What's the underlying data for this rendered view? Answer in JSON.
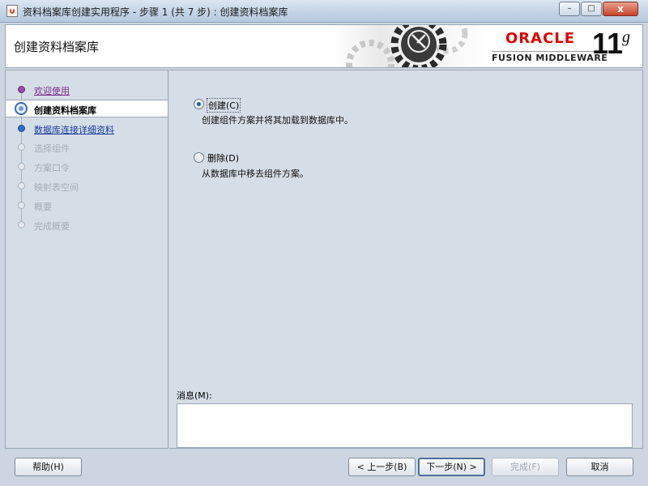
{
  "window": {
    "title": "资料档案库创建实用程序 - 步骤 1 (共 7 步) : 创建资料档案库",
    "minimize": "–",
    "maximize": "□",
    "close": "x"
  },
  "header": {
    "page_title": "创建资料档案库",
    "brand": "ORACLE",
    "product": "FUSION MIDDLEWARE",
    "version": "11",
    "version_suffix": "g"
  },
  "steps": [
    {
      "label": "欢迎使用",
      "state": "visited"
    },
    {
      "label": "创建资料档案库",
      "state": "current"
    },
    {
      "label": "数据库连接详细资料",
      "state": "link"
    },
    {
      "label": "选择组件",
      "state": "disabled"
    },
    {
      "label": "方案口令",
      "state": "disabled"
    },
    {
      "label": "映射表空间",
      "state": "disabled"
    },
    {
      "label": "概要",
      "state": "disabled"
    },
    {
      "label": "完成概要",
      "state": "disabled"
    }
  ],
  "options": {
    "create": {
      "label": "创建(C)",
      "desc": "创建组件方案并将其加载到数据库中。",
      "selected": true
    },
    "drop": {
      "label": "删除(D)",
      "desc": "从数据库中移去组件方案。",
      "selected": false
    }
  },
  "messages": {
    "label": "消息(M):",
    "text": ""
  },
  "buttons": {
    "help": "帮助(H)",
    "back": "< 上一步(B)",
    "next": "下一步(N) >",
    "finish": "完成(F)",
    "cancel": "取消"
  },
  "colors": {
    "oracle_red": "#e00000",
    "visited": "#7a2a8a",
    "link": "#1a3a9a"
  }
}
